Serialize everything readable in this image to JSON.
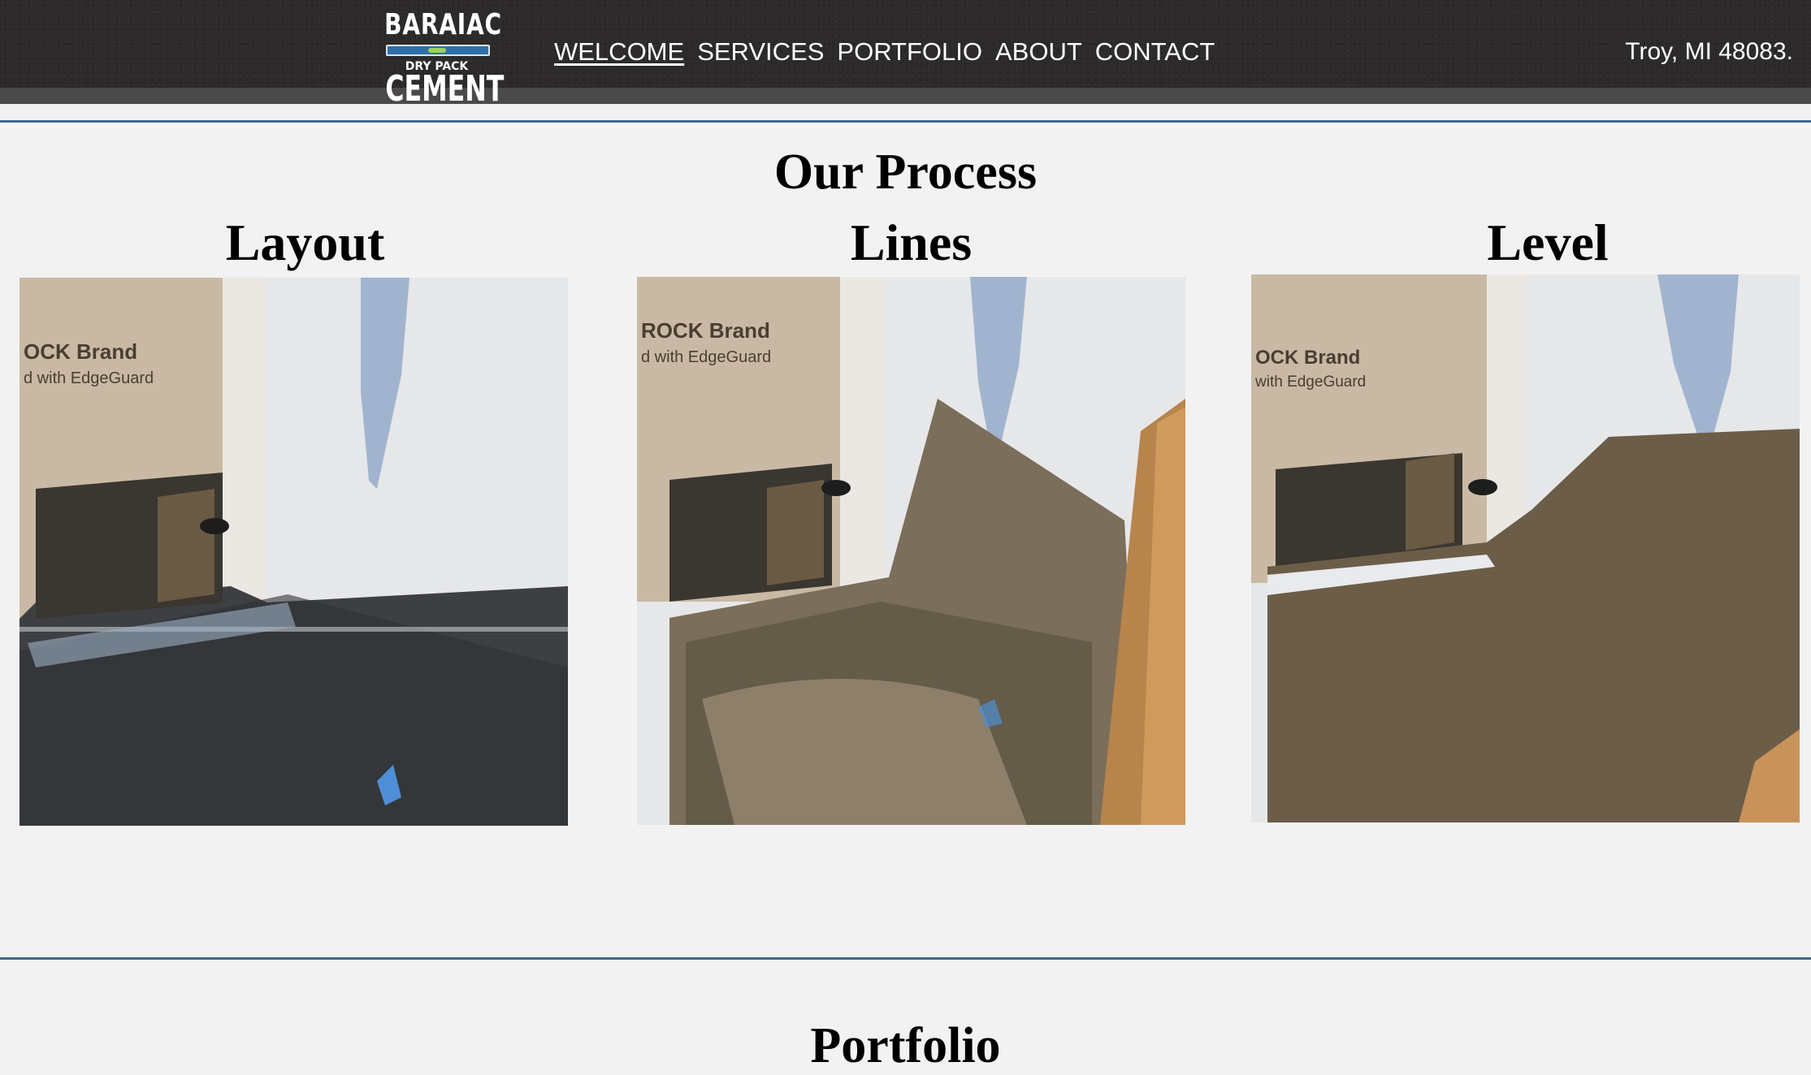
{
  "header": {
    "logo": {
      "line1": "BARAIAC",
      "line2": "DRY PACK",
      "line3": "CEMENT"
    },
    "nav": [
      {
        "label": "WELCOME",
        "active": true
      },
      {
        "label": "SERVICES",
        "active": false
      },
      {
        "label": "PORTFOLIO",
        "active": false
      },
      {
        "label": "ABOUT",
        "active": false
      },
      {
        "label": "CONTACT",
        "active": false
      }
    ],
    "location": "Troy, MI 48083."
  },
  "process": {
    "title": "Our Process",
    "steps": [
      {
        "title": "Layout",
        "image": "shower-floor-membrane-photo"
      },
      {
        "title": "Lines",
        "image": "shower-floor-mortar-lines-photo"
      },
      {
        "title": "Level",
        "image": "shower-floor-leveled-mortar-photo"
      }
    ]
  },
  "portfolio": {
    "title": "Portfolio"
  },
  "colors": {
    "header_bg": "#2d2b2a",
    "page_bg": "#f2f2f2",
    "divider": "#3c6a90"
  }
}
